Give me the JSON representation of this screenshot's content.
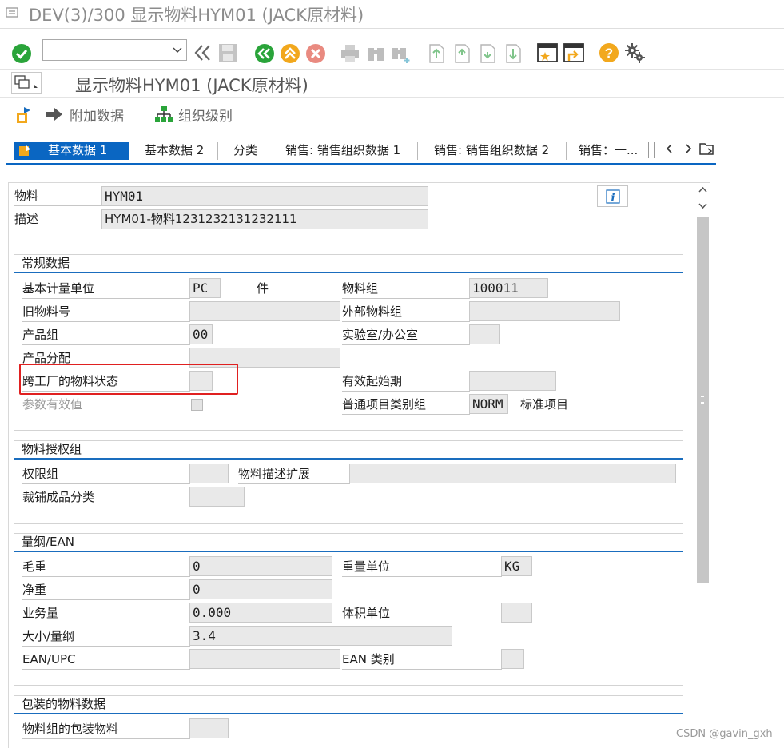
{
  "window_title": "DEV(3)/300 显示物料HYM01 (JACK原材料)",
  "screen_title": "显示物料HYM01 (JACK原材料)",
  "app_toolbar": {
    "additional_data": "附加数据",
    "org_levels": "组织级别"
  },
  "tabs": [
    "基本数据 1",
    "基本数据 2",
    "分类",
    "销售: 销售组织数据 1",
    "销售: 销售组织数据 2",
    "销售：一..."
  ],
  "header": {
    "material_label": "物料",
    "material_value": "HYM01",
    "desc_label": "描述",
    "desc_value": "HYM01-物料1231232131232111"
  },
  "general": {
    "title": "常规数据",
    "base_uom_label": "基本计量单位",
    "base_uom_value": "PC",
    "base_uom_text": "件",
    "matl_group_label": "物料组",
    "matl_group_value": "100011",
    "old_matl_label": "旧物料号",
    "old_matl_value": "",
    "ext_matl_group_label": "外部物料组",
    "ext_matl_group_value": "",
    "division_label": "产品组",
    "division_value": "00",
    "lab_office_label": "实验室/办公室",
    "lab_office_value": "",
    "prod_alloc_label": "产品分配",
    "prod_alloc_value": "",
    "xplant_status_label": "跨工厂的物料状态",
    "xplant_status_value": "",
    "valid_from_label": "有效起始期",
    "valid_from_value": "",
    "param_eff_label": "参数有效值",
    "item_cat_label": "普通项目类别组",
    "item_cat_value": "NORM",
    "item_cat_text": "标准项目"
  },
  "auth": {
    "title": "物料授权组",
    "auth_group_label": "权限组",
    "auth_group_value": "",
    "desc_ext_label": "物料描述扩展",
    "desc_ext_value": "",
    "apparel_label": "裁铺成品分类",
    "apparel_value": ""
  },
  "dims": {
    "title": "量纲/EAN",
    "gross_weight_label": "毛重",
    "gross_weight_value": "0",
    "weight_unit_label": "重量单位",
    "weight_unit_value": "KG",
    "net_weight_label": "净重",
    "net_weight_value": "0",
    "volume_label": "业务量",
    "volume_value": "0.000",
    "volume_unit_label": "体积单位",
    "volume_unit_value": "",
    "size_label": "大小/量纲",
    "size_value": "3.4",
    "ean_label": "EAN/UPC",
    "ean_value": "",
    "ean_cat_label": "EAN 类别",
    "ean_cat_value": ""
  },
  "packaging": {
    "title": "包装的物料数据",
    "pack_matl_group_label": "物料组的包装物料",
    "pack_matl_group_value": ""
  },
  "watermark": "CSDN @gavin_gxh",
  "colors": {
    "accent_blue": "#1a6dbe",
    "tab_active": "#0a66c2",
    "highlight_red": "#e02020",
    "ok_green": "#2aa43a",
    "nav_yellow": "#f2a81d",
    "cancel_red": "#e04a3a"
  }
}
